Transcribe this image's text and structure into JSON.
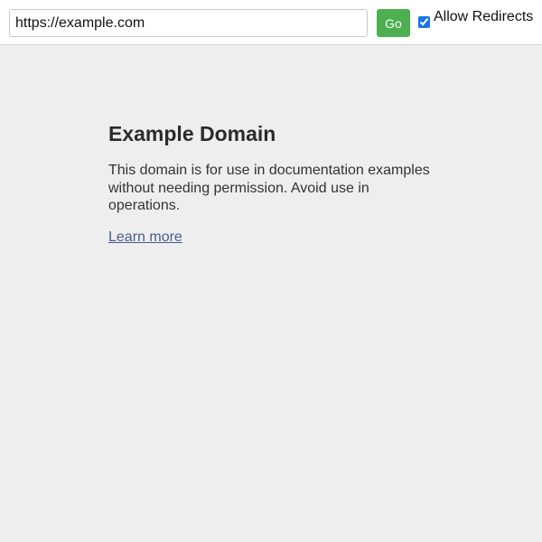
{
  "toolbar": {
    "url_value": "https://example.com",
    "go_label": "Go",
    "allow_redirects_label": "Allow Redirects",
    "allow_redirects_checked": true
  },
  "page": {
    "title": "Example Domain",
    "body_text": "This domain is for use in documentation examples without needing permission. Avoid use in operations.",
    "link_text": "Learn more"
  },
  "colors": {
    "go_button": "#4caf50",
    "checkbox_accent": "#1a73e8",
    "page_background": "#eeeeee",
    "link": "#4b5a8a"
  }
}
